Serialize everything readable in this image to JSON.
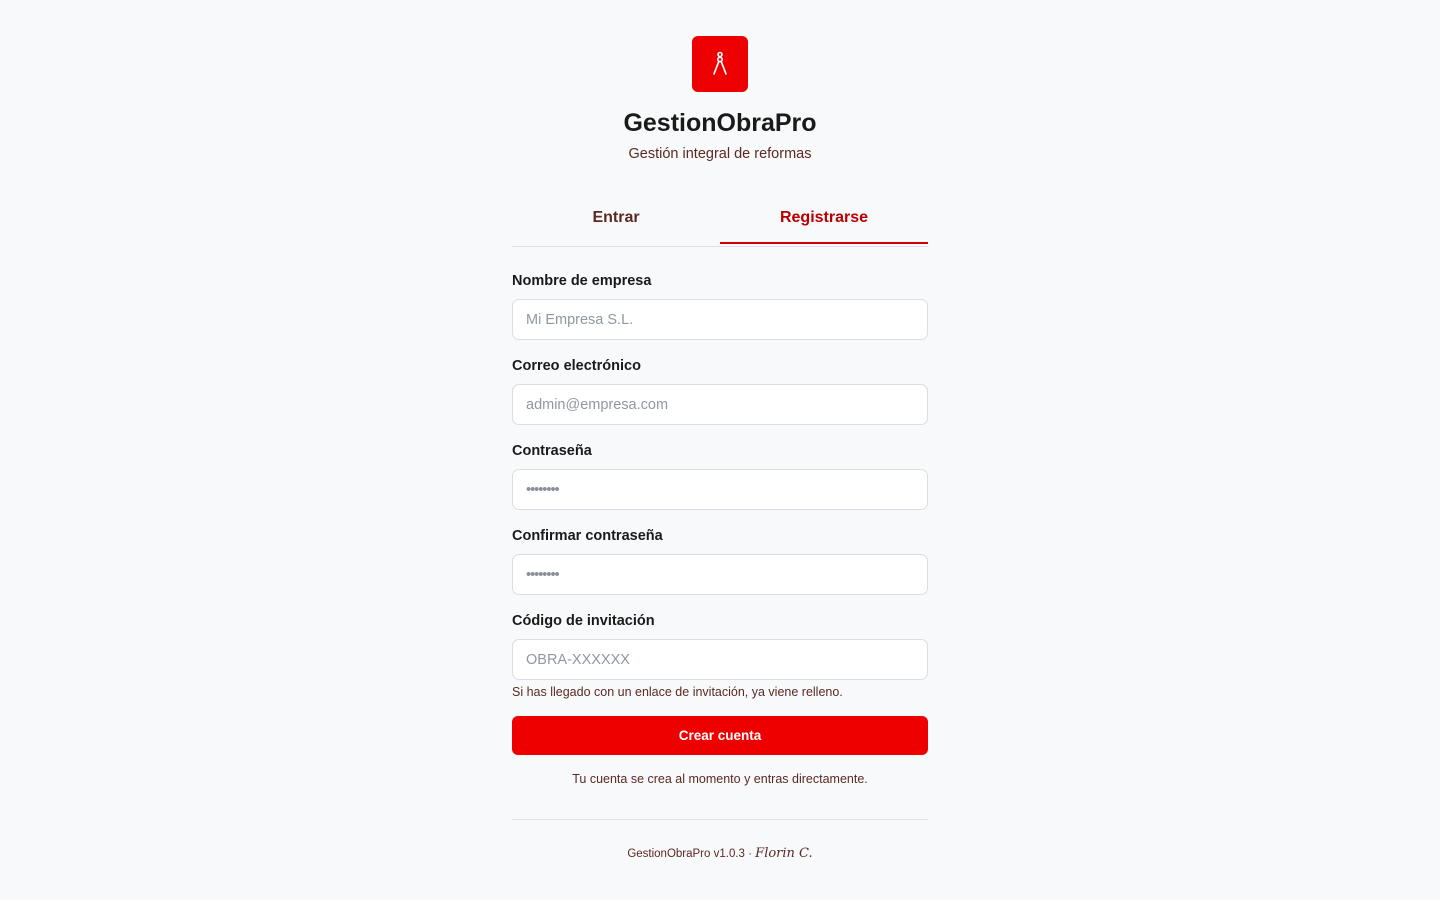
{
  "brand": {
    "name": "GestionObraPro",
    "subtitle": "Gestión integral de reformas",
    "logo_icon": "drafting-compass-icon",
    "accent_color": "#ee0000"
  },
  "tabs": [
    {
      "label": "Entrar",
      "active": false
    },
    {
      "label": "Registrarse",
      "active": true
    }
  ],
  "tab_active_color": "#b80000",
  "form": {
    "company": {
      "label": "Nombre de empresa",
      "placeholder": "Mi Empresa S.L."
    },
    "email": {
      "label": "Correo electrónico",
      "placeholder": "admin@empresa.com"
    },
    "password": {
      "label": "Contraseña",
      "placeholder": "••••••••"
    },
    "confirm_password": {
      "label": "Confirmar contraseña",
      "placeholder": "••••••••"
    },
    "invite_code": {
      "label": "Código de invitación",
      "placeholder": "OBRA-XXXXXX"
    },
    "invite_hint": "Si has llegado con un enlace de invitación, ya viene relleno.",
    "submit_label": "Crear cuenta",
    "note": "Tu cuenta se crea al momento y entras directamente."
  },
  "footer": {
    "version_text": "GestionObraPro v1.0.3 ·",
    "signature": "Florin C."
  }
}
